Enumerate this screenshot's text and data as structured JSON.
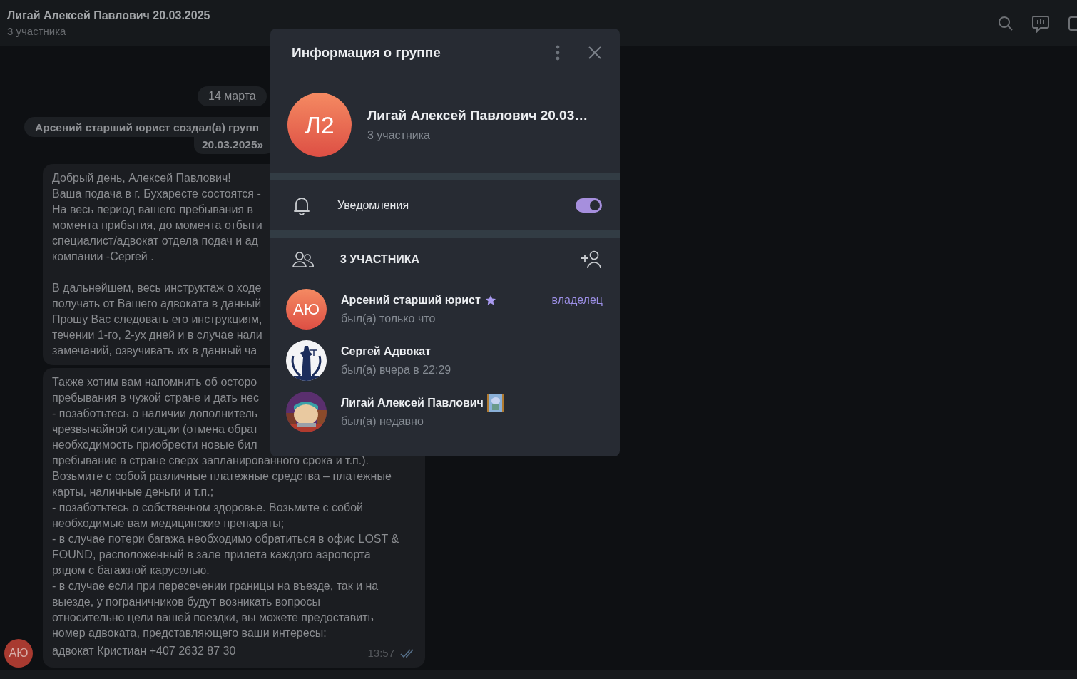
{
  "header": {
    "title": "Лигай Алексей Павлович 20.03.2025",
    "subtitle": "3 участника"
  },
  "chat": {
    "date": "14 марта",
    "service_lines": [
      "Арсений старший юрист создал(а) групп",
      "20.03.2025»"
    ],
    "sender_avatar": {
      "initials": "АЮ",
      "color": "#a83a30"
    },
    "messages": [
      {
        "paragraphs": [
          [
            "Добрый день,  Алексей Павлович!",
            "Ваша подача  в г. Бухаресте состоятся -",
            "На весь период вашего пребывания в",
            "момента прибытия, до момента отбыти",
            "специалист/адвокат отдела подач и ад",
            "компании -Сергей  ."
          ],
          [
            "В дальнейшем, весь инструктаж о ходе",
            "получать от Вашего адвоката в данный",
            "Прошу Вас следовать его инструкциям,",
            "течении 1-го, 2-ух дней и в случае нали",
            "замечаний, озвучивать их в данный ча"
          ]
        ]
      },
      {
        "paragraphs": [
          [
            "Также хотим вам напомнить об осторо",
            "пребывания в чужой стране и дать нес",
            "- позаботьтесь о наличии дополнитель",
            "чрезвычайной ситуации (отмена обрат",
            "необходимость приобрести новые бил",
            "пребывание в стране сверх запланированного срока и т.п.).",
            "Возьмите с собой различные платежные средства – платежные",
            "карты, наличные деньги и т.п.;",
            "- позаботьтесь о собственном здоровье. Возьмите с собой",
            "необходимые вам медицинские препараты;",
            "- в случае потери багажа необходимо обратиться в офис LOST &",
            "FOUND, расположенный в зале прилета каждого аэропорта",
            "рядом с багажной каруселью.",
            "- в случае если при пересечении границы на въезде, так и на",
            "выезде, у пограничников будут возникать вопросы",
            "относительно цели вашей поездки, вы можете предоставить",
            "номер адвоката, представляющего ваши интересы:",
            "адвокат Кристиан +407 2632 87 30"
          ]
        ],
        "time": "13:57",
        "read": true
      }
    ]
  },
  "dialog": {
    "title": "Информация о группе",
    "group": {
      "avatar_text": "Л2",
      "name": "Лигай Алексей Павлович 20.03…",
      "subtitle": "3 участника"
    },
    "notifications": {
      "label": "Уведомления",
      "on": true
    },
    "members_header": "3 УЧАСТНИКА",
    "members": [
      {
        "name": "Арсений старший юрист",
        "status": "был(а) только что",
        "avatar": {
          "kind": "initials",
          "text": "АЮ"
        },
        "premium": true,
        "emoji_status": false,
        "role": "владелец"
      },
      {
        "name": "Сергей Адвокат",
        "status": "был(а) вчера в 22:29",
        "premium": false,
        "emoji_status": false
      },
      {
        "name": "Лигай Алексей Павлович",
        "status": "был(а) недавно",
        "premium": false,
        "emoji_status": true
      }
    ]
  }
}
